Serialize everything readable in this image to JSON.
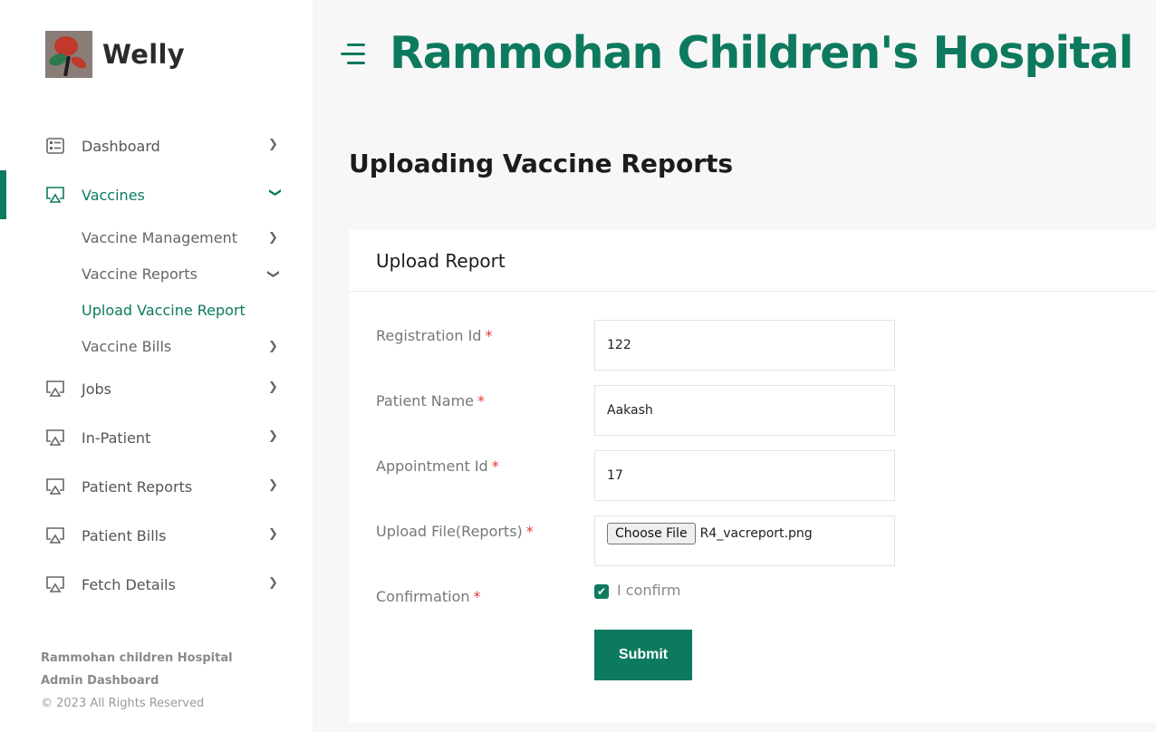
{
  "brand": {
    "name": "Welly"
  },
  "header": {
    "title": "Rammohan Children's Hospital"
  },
  "sidebar": {
    "items": [
      {
        "label": "Dashboard",
        "icon": "dashboard-icon"
      },
      {
        "label": "Vaccines",
        "icon": "monitor-icon"
      },
      {
        "label": "Jobs",
        "icon": "monitor-icon"
      },
      {
        "label": "In-Patient",
        "icon": "monitor-icon"
      },
      {
        "label": "Patient Reports",
        "icon": "monitor-icon"
      },
      {
        "label": "Patient Bills",
        "icon": "monitor-icon"
      },
      {
        "label": "Fetch Details",
        "icon": "monitor-icon"
      }
    ],
    "vaccine_sub": [
      {
        "label": "Vaccine Management"
      },
      {
        "label": "Vaccine Reports"
      },
      {
        "label": "Upload Vaccine Report"
      },
      {
        "label": "Vaccine Bills"
      }
    ]
  },
  "footer": {
    "line1": "Rammohan children Hospital",
    "line2": "Admin Dashboard",
    "line3": "© 2023 All Rights Reserved"
  },
  "page": {
    "title": "Uploading Vaccine Reports"
  },
  "card": {
    "title": "Upload Report",
    "fields": {
      "registration": {
        "label": "Registration Id",
        "value": "122"
      },
      "patient_name": {
        "label": "Patient Name",
        "value": "Aakash"
      },
      "appointment": {
        "label": "Appointment Id",
        "value": "17"
      },
      "upload": {
        "label": "Upload File(Reports)",
        "button": "Choose File",
        "file": "R4_vacreport.png"
      },
      "confirmation": {
        "label": "Confirmation",
        "checkbox_label": "I confirm",
        "checked": true
      }
    },
    "required_mark": "*",
    "submit_label": "Submit"
  },
  "colors": {
    "accent": "#0d7a5f",
    "required": "#e53935"
  }
}
